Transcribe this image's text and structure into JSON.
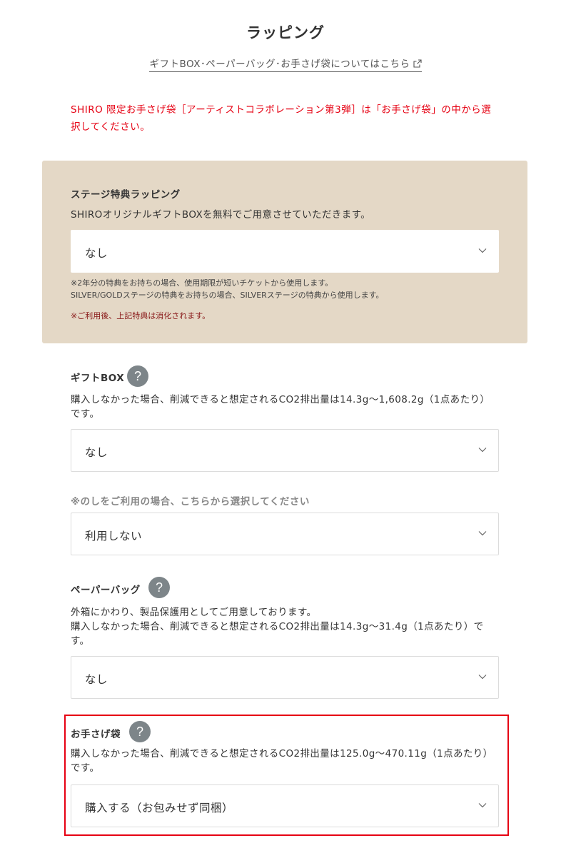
{
  "page": {
    "title": "ラッピング",
    "info_link": "ギフトBOX･ペーパーバッグ･お手さげ袋についてはこちら",
    "notice": "SHIRO 限定お手さげ袋［アーティストコラボレーション第3弾］は「お手さげ袋」の中から選択してください。"
  },
  "stage": {
    "title": "ステージ特典ラッピング",
    "desc": "SHIROオリジナルギフトBOXを無料でご用意させていただきます。",
    "select_value": "なし",
    "note1": "※2年分の特典をお持ちの場合、使用期限が短いチケットから使用します。",
    "note2": "SILVER/GOLDステージの特典をお持ちの場合、SILVERステージの特典から使用します。",
    "warn": "※ご利用後、上記特典は消化されます。"
  },
  "giftbox": {
    "title": "ギフトBOX",
    "help": "?",
    "desc": "購入しなかった場合、削減できると想定されるCO2排出量は14.3g〜1,608.2g（1点あたり）です。",
    "select_value": "なし"
  },
  "noshi": {
    "title": "※のしをご利用の場合、こちらから選択してください",
    "select_value": "利用しない"
  },
  "paperbag": {
    "title": "ペーパーバッグ",
    "help": "?",
    "desc1": "外箱にかわり、製品保護用としてご用意しております。",
    "desc2": "購入しなかった場合、削減できると想定されるCO2排出量は14.3g〜31.4g（1点あたり）です。",
    "select_value": "なし"
  },
  "handbag": {
    "title": "お手さげ袋",
    "help": "?",
    "desc": "購入しなかった場合、削減できると想定されるCO2排出量は125.0g〜470.11g（1点あたり）です。",
    "select_value": "購入する（お包みせず同梱）"
  },
  "icons": {
    "external_link": "external-link-icon",
    "help": "question-mark-icon",
    "chevron": "chevron-down-icon"
  },
  "colors": {
    "notice_red": "#e60012",
    "panel_beige": "#e4d8c6",
    "help_gray": "#7d8589"
  }
}
